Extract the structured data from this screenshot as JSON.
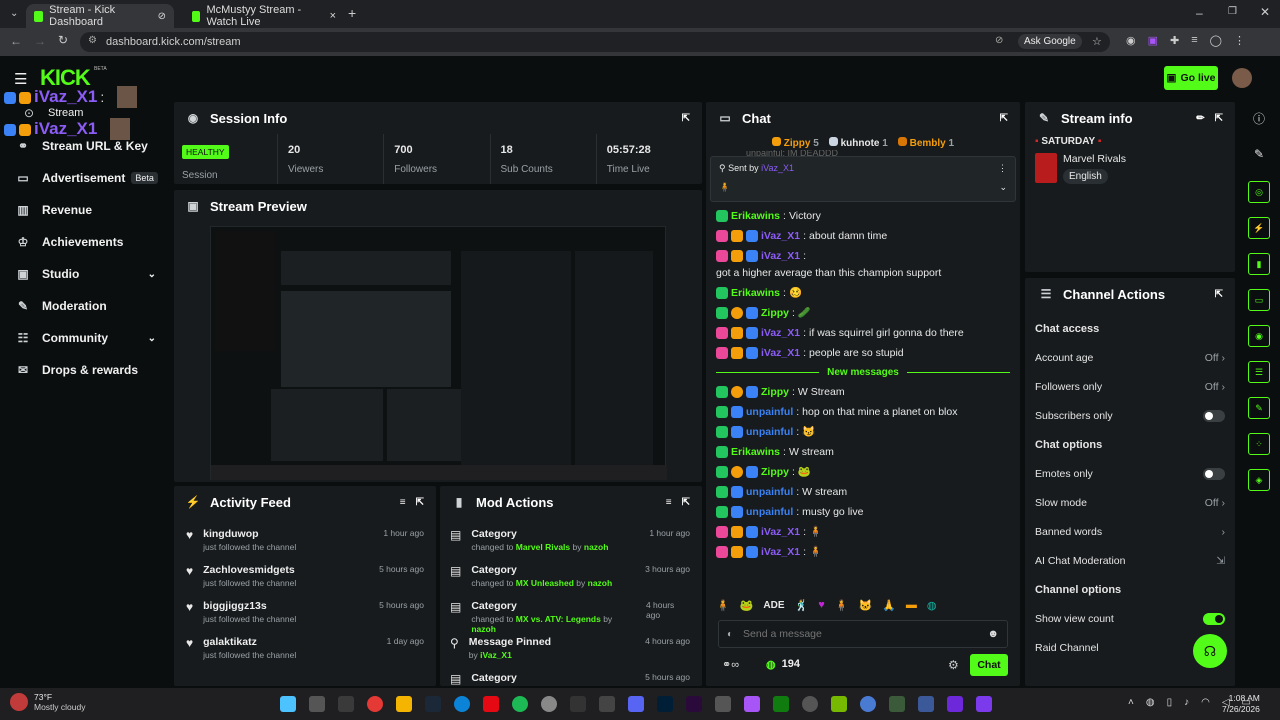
{
  "browser": {
    "tabs": [
      {
        "label": "Stream - Kick Dashboard",
        "active": true
      },
      {
        "label": "McMustyy Stream - Watch Live",
        "active": false
      }
    ],
    "url": "dashboard.kick.com/stream",
    "ask_google": "Ask Google"
  },
  "app": {
    "logo": "KICK",
    "logo_sup": "BETA",
    "go_live": "Go live"
  },
  "overlay": {
    "user1": "iVaz_X1",
    "user2": "iVaz_X1",
    "sep": ":"
  },
  "sidebar": {
    "items": [
      {
        "label": "Stream",
        "icon": "stream-icon"
      },
      {
        "label": "Stream URL & Key",
        "icon": "link-icon"
      },
      {
        "label": "Advertisement",
        "badge": "Beta",
        "icon": "ad-icon"
      },
      {
        "label": "Revenue",
        "icon": "chart-icon"
      },
      {
        "label": "Achievements",
        "icon": "trophy-icon"
      },
      {
        "label": "Studio",
        "icon": "tv-icon",
        "chevron": true
      },
      {
        "label": "Moderation",
        "icon": "wrench-icon"
      },
      {
        "label": "Community",
        "icon": "community-icon",
        "chevron": true
      },
      {
        "label": "Drops & rewards",
        "icon": "gift-icon"
      }
    ]
  },
  "session": {
    "title": "Session Info",
    "status": "HEALTHY",
    "status_label": "Session",
    "stats": [
      {
        "value": "20",
        "label": "Viewers"
      },
      {
        "value": "700",
        "label": "Followers"
      },
      {
        "value": "18",
        "label": "Sub Counts"
      },
      {
        "value": "05:57:28",
        "label": "Time Live"
      }
    ]
  },
  "preview": {
    "title": "Stream Preview"
  },
  "activity": {
    "title": "Activity Feed",
    "items": [
      {
        "name": "kingduwop",
        "sub": "just followed the channel",
        "time": "1 hour ago"
      },
      {
        "name": "Zachlovesmidgets",
        "sub": "just followed the channel",
        "time": "5 hours ago"
      },
      {
        "name": "biggjiggz13s",
        "sub": "just followed the channel",
        "time": "5 hours ago"
      },
      {
        "name": "galaktikatz",
        "sub": "just followed the channel",
        "time": "1 day ago"
      }
    ]
  },
  "modactions": {
    "title": "Mod Actions",
    "items": [
      {
        "title": "Category",
        "pre": "changed to",
        "target": "Marvel Rivals",
        "by": "by",
        "user": "nazoh",
        "time": "1 hour ago"
      },
      {
        "title": "Category",
        "pre": "changed to",
        "target": "MX Unleashed",
        "by": "by",
        "user": "nazoh",
        "time": "3 hours ago"
      },
      {
        "title": "Category",
        "pre": "changed to",
        "target": "MX vs. ATV: Legends",
        "by": "by",
        "user": "nazoh",
        "time": "4 hours ago"
      },
      {
        "title": "Message Pinned",
        "pre": "by",
        "target": "",
        "by": "",
        "user": "iVaz_X1",
        "time": "4 hours ago"
      },
      {
        "title": "Category",
        "pre": "",
        "target": "",
        "by": "",
        "user": "",
        "time": "5 hours ago"
      }
    ]
  },
  "chat": {
    "title": "Chat",
    "top_gifters": [
      {
        "name": "Zippy",
        "count": "5"
      },
      {
        "name": "kuhnote",
        "count": "1"
      },
      {
        "name": "Bembly",
        "count": "1"
      }
    ],
    "cut_line": "unpainful: IM DEADDD",
    "pinned": {
      "label": "Sent by",
      "user": "iVaz_X1"
    },
    "messages": [
      {
        "user": "Erikawins",
        "color": "#53fc18",
        "text": "Victory"
      },
      {
        "user": "iVaz_X1",
        "color": "#8b5cf6",
        "text": "about damn time"
      },
      {
        "user": "iVaz_X1",
        "color": "#8b5cf6",
        "text": "got a higher average than this champion support"
      },
      {
        "user": "Erikawins",
        "color": "#53fc18",
        "text": "🥴"
      },
      {
        "user": "Zippy",
        "color": "#53fc18",
        "text": "🥒"
      },
      {
        "user": "iVaz_X1",
        "color": "#8b5cf6",
        "text": "if was squirrel girl gonna do there"
      },
      {
        "user": "iVaz_X1",
        "color": "#8b5cf6",
        "text": "people are so stupid"
      }
    ],
    "new_messages": "New messages",
    "messages2": [
      {
        "user": "Zippy",
        "color": "#53fc18",
        "text": "W Stream"
      },
      {
        "user": "unpainful",
        "color": "#3b82f6",
        "text": "hop on that mine a planet on blox"
      },
      {
        "user": "unpainful",
        "color": "#3b82f6",
        "text": "😼"
      },
      {
        "user": "Erikawins",
        "color": "#53fc18",
        "text": "W stream"
      },
      {
        "user": "Zippy",
        "color": "#53fc18",
        "text": "🐸"
      },
      {
        "user": "unpainful",
        "color": "#3b82f6",
        "text": "W stream"
      },
      {
        "user": "unpainful",
        "color": "#3b82f6",
        "text": "musty go live"
      },
      {
        "user": "iVaz_X1",
        "color": "#8b5cf6",
        "text": "🧍"
      },
      {
        "user": "iVaz_X1",
        "color": "#8b5cf6",
        "text": "🧍"
      }
    ],
    "emote_ade": "ADE",
    "placeholder": "Send a message",
    "points": "194",
    "send": "Chat"
  },
  "streaminfo": {
    "title": "Stream info",
    "headline": "SATURDAY",
    "category": "Marvel Rivals",
    "language": "English"
  },
  "channelactions": {
    "title": "Channel Actions",
    "chat_access": "Chat access",
    "account_age": "Account age",
    "account_age_val": "Off",
    "followers_only": "Followers only",
    "followers_only_val": "Off",
    "subscribers_only": "Subscribers only",
    "chat_options": "Chat options",
    "emotes_only": "Emotes only",
    "slow_mode": "Slow mode",
    "slow_mode_val": "Off",
    "banned_words": "Banned words",
    "ai_mod": "AI Chat Moderation",
    "channel_options": "Channel options",
    "show_view_count": "Show view count",
    "raid": "Raid Channel"
  },
  "taskbar": {
    "temp": "73°F",
    "weather": "Mostly cloudy",
    "time": "1:08 AM",
    "date": "7/26/2026"
  },
  "colors": {
    "accent": "#53fc18",
    "bg": "#0b0e0f",
    "panel": "#171b1d"
  }
}
